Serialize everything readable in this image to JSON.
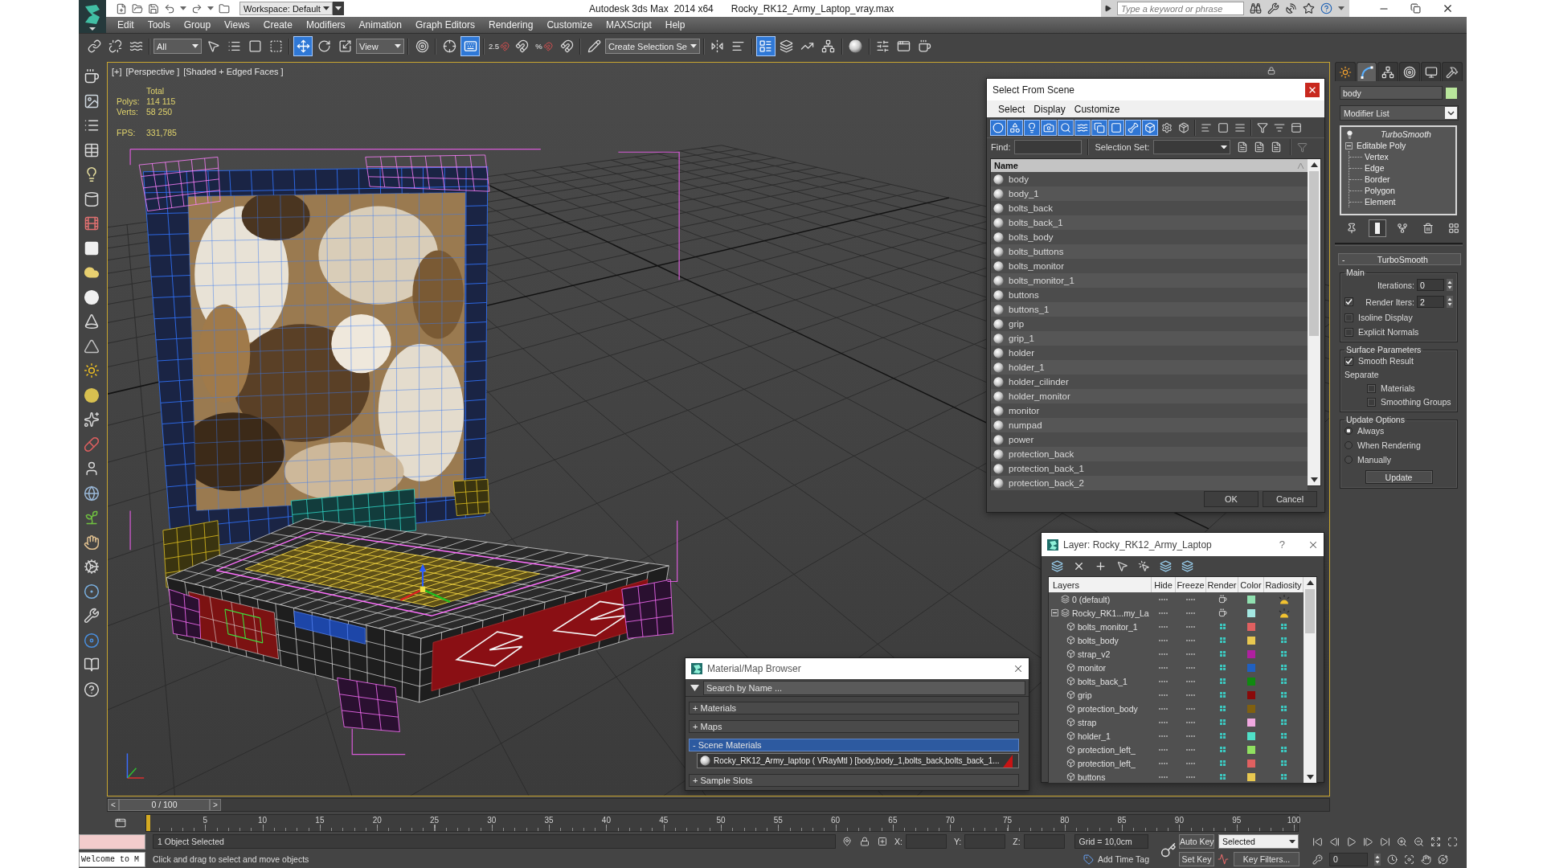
{
  "title_bar": {
    "workspace": "Workspace: Default",
    "app_name": "Autodesk 3ds Max  2014 x64",
    "file_name": "Rocky_RK12_Army_Laptop_vray.max",
    "search": {
      "placeholder": "Type a keyword or phrase"
    }
  },
  "menu_bar": [
    "Edit",
    "Tools",
    "Group",
    "Views",
    "Create",
    "Modifiers",
    "Animation",
    "Graph Editors",
    "Rendering",
    "Customize",
    "MAXScript",
    "Help"
  ],
  "main_toolbar": [
    {
      "kind": "tool",
      "active": false
    },
    {
      "kind": "tool",
      "active": false
    },
    {
      "kind": "tool",
      "active": false
    },
    {
      "kind": "dropdown",
      "value": "All"
    },
    {
      "kind": "tool",
      "active": false
    },
    {
      "kind": "tool",
      "active": false
    },
    {
      "kind": "tool",
      "active": false
    },
    {
      "kind": "tool",
      "active": false
    },
    {
      "kind": "tool",
      "active": true
    },
    {
      "kind": "tool",
      "active": false
    },
    {
      "kind": "tool",
      "active": false
    },
    {
      "kind": "dropdown",
      "value": "View"
    },
    {
      "kind": "tool",
      "active": false
    },
    {
      "kind": "tool",
      "active": false
    },
    {
      "kind": "tool",
      "active": true
    },
    {
      "kind": "snap",
      "label": "2.5",
      "active": false
    },
    {
      "kind": "tool",
      "active": false
    },
    {
      "kind": "snap",
      "label": "%",
      "active": false
    },
    {
      "kind": "tool",
      "active": false
    },
    {
      "kind": "tool",
      "active": false
    },
    {
      "kind": "dropdown",
      "value": "Create Selection Se"
    },
    {
      "kind": "tool",
      "active": false
    },
    {
      "kind": "tool",
      "active": false
    },
    {
      "kind": "tool",
      "active": true
    },
    {
      "kind": "tool",
      "active": false
    },
    {
      "kind": "tool",
      "active": false
    },
    {
      "kind": "tool",
      "active": false
    },
    {
      "kind": "tool",
      "active": false
    },
    {
      "kind": "tool",
      "active": false
    },
    {
      "kind": "tool",
      "active": false
    },
    {
      "kind": "tool",
      "active": false
    }
  ],
  "viewport": {
    "menus": [
      "[+]",
      "[Perspective ]",
      "[Shaded + Edged Faces ]"
    ],
    "stats": {
      "heading": "Total",
      "rows": [
        {
          "label": "Polys:",
          "value": "114 115"
        },
        {
          "label": "Verts:",
          "value": "58 250"
        }
      ],
      "fps": {
        "label": "FPS:",
        "value": "331,785"
      }
    }
  },
  "select_from_scene": {
    "title": "Select From Scene",
    "menu": [
      "Select",
      "Display",
      "Customize"
    ],
    "filters": [
      {
        "active": true
      },
      {
        "active": true
      },
      {
        "active": true
      },
      {
        "active": true
      },
      {
        "active": true
      },
      {
        "active": true
      },
      {
        "active": true
      },
      {
        "active": true
      },
      {
        "active": true
      },
      {
        "active": true
      },
      {
        "active": false
      },
      {
        "active": false
      }
    ],
    "find_label": "Find:",
    "selection_set_label": "Selection Set:",
    "column": "Name",
    "rows": [
      {
        "name": "body",
        "selected": false
      },
      {
        "name": "body_1",
        "selected": false
      },
      {
        "name": "bolts_back",
        "selected": false
      },
      {
        "name": "bolts_back_1",
        "selected": false
      },
      {
        "name": "bolts_body",
        "selected": false
      },
      {
        "name": "bolts_buttons",
        "selected": false
      },
      {
        "name": "bolts_monitor",
        "selected": false
      },
      {
        "name": "bolts_monitor_1",
        "selected": false
      },
      {
        "name": "buttons",
        "selected": false
      },
      {
        "name": "buttons_1",
        "selected": false
      },
      {
        "name": "grip",
        "selected": false
      },
      {
        "name": "grip_1",
        "selected": false
      },
      {
        "name": "holder",
        "selected": false
      },
      {
        "name": "holder_1",
        "selected": false
      },
      {
        "name": "holder_cilinder",
        "selected": false
      },
      {
        "name": "holder_monitor",
        "selected": false
      },
      {
        "name": "monitor",
        "selected": false
      },
      {
        "name": "numpad",
        "selected": false
      },
      {
        "name": "power",
        "selected": false
      },
      {
        "name": "protection_back",
        "selected": false
      },
      {
        "name": "protection_back_1",
        "selected": false
      },
      {
        "name": "protection_back_2",
        "selected": false
      }
    ],
    "buttons": [
      "OK",
      "Cancel"
    ]
  },
  "layer_dialog": {
    "title": "Layer: Rocky_RK12_Army_Laptop",
    "help": "?",
    "columns": [
      "Layers",
      "Hide",
      "Freeze",
      "Render",
      "Color",
      "Radiosity"
    ],
    "rows": [
      {
        "kind": "layer",
        "name": "0 (default)",
        "color": "#90e0b0",
        "selected": false
      },
      {
        "kind": "layer",
        "name": "Rocky_RK1...my_La",
        "color": "#a4e8e2",
        "selected": false,
        "expanded": true,
        "children": [
          {
            "kind": "object",
            "name": "bolts_monitor_1",
            "color": "#e06060",
            "selected": false
          },
          {
            "kind": "object",
            "name": "bolts_body",
            "color": "#e8c850",
            "selected": false
          },
          {
            "kind": "object",
            "name": "strap_v2",
            "color": "#b020a0",
            "selected": false
          },
          {
            "kind": "object",
            "name": "monitor",
            "color": "#2060c0",
            "selected": false
          },
          {
            "kind": "object",
            "name": "bolts_back_1",
            "color": "#108a10",
            "selected": false
          },
          {
            "kind": "object",
            "name": "grip",
            "color": "#8a0a0a",
            "selected": false
          },
          {
            "kind": "object",
            "name": "protection_body",
            "color": "#806010",
            "selected": false
          },
          {
            "kind": "object",
            "name": "strap",
            "color": "#f0a8e0",
            "selected": false
          },
          {
            "kind": "object",
            "name": "holder_1",
            "color": "#50e0c8",
            "selected": false
          },
          {
            "kind": "object",
            "name": "protection_left_",
            "color": "#90e060",
            "selected": false
          },
          {
            "kind": "object",
            "name": "protection_left_",
            "color": "#e06060",
            "selected": false
          },
          {
            "kind": "object",
            "name": "buttons",
            "color": "#e8c850",
            "selected": false
          }
        ]
      }
    ]
  },
  "material_browser": {
    "title": "Material/Map Browser",
    "search": {
      "placeholder": "Search by Name ..."
    },
    "groups": [
      {
        "label": "+ Materials",
        "expanded": false
      },
      {
        "label": "+ Maps",
        "expanded": false
      },
      {
        "label": "- Scene Materials",
        "expanded": true,
        "items": [
          {
            "label": "Rocky_RK12_Army_laptop ( VRayMtl ) [body,body_1,bolts_back,bolts_back_1...",
            "selected": false
          }
        ]
      },
      {
        "label": "+ Sample Slots",
        "expanded": false
      }
    ]
  },
  "command_panel": {
    "tabs": [
      {
        "selected": false
      },
      {
        "selected": true
      },
      {
        "selected": false
      },
      {
        "selected": false
      },
      {
        "selected": false
      },
      {
        "selected": false
      }
    ],
    "object_name": "body",
    "modifier_list": "Modifier List",
    "stack": [
      {
        "kind": "modifier",
        "name": "TurboSmooth",
        "selected": false
      },
      {
        "kind": "base",
        "name": "Editable Poly",
        "selected": false,
        "expanded": true,
        "children": [
          {
            "name": "Vertex",
            "selected": false
          },
          {
            "name": "Edge",
            "selected": false
          },
          {
            "name": "Border",
            "selected": false
          },
          {
            "name": "Polygon",
            "selected": false
          },
          {
            "name": "Element",
            "selected": false
          }
        ]
      }
    ],
    "stack_tools": [
      {
        "active": false
      },
      {
        "active": true
      },
      {
        "active": false
      },
      {
        "active": false
      },
      {
        "active": false
      }
    ],
    "rollout": {
      "sign": "-",
      "title": "TurboSmooth",
      "groups": [
        {
          "title": "Main",
          "controls": [
            {
              "kind": "spinner",
              "label": "Iterations:",
              "value": "0"
            },
            {
              "kind": "spinner",
              "label": "Render Iters:",
              "value": "2",
              "checked": true
            },
            {
              "kind": "checkbox",
              "label": "Isoline Display",
              "checked": false
            },
            {
              "kind": "checkbox",
              "label": "Explicit Normals",
              "checked": false
            }
          ]
        },
        {
          "title": "Surface Parameters",
          "controls": [
            {
              "kind": "checkbox",
              "label": "Smooth Result",
              "checked": true
            },
            {
              "kind": "heading",
              "label": "Separate",
              "children": [
                {
                  "kind": "checkbox",
                  "label": "Materials",
                  "checked": false
                },
                {
                  "kind": "checkbox",
                  "label": "Smoothing Groups",
                  "checked": false
                }
              ]
            }
          ]
        },
        {
          "title": "Update Options",
          "controls": [
            {
              "kind": "radio",
              "label": "Always",
              "selected": true
            },
            {
              "kind": "radio",
              "label": "When Rendering",
              "selected": false
            },
            {
              "kind": "radio",
              "label": "Manually",
              "selected": false
            },
            {
              "kind": "button",
              "label": "Update"
            }
          ]
        }
      ]
    }
  },
  "time_slider": {
    "prev": "<",
    "position": "0 / 100",
    "next": ">",
    "level": 0
  },
  "track_bar": {
    "labels": [
      "5",
      "10",
      "15",
      "20",
      "25",
      "30",
      "35",
      "40",
      "45",
      "50",
      "55",
      "60",
      "65",
      "70",
      "75",
      "80",
      "85",
      "90",
      "95",
      "100"
    ]
  },
  "status_bar": {
    "selection": "1 Object Selected",
    "coords": [
      {
        "label": "X:"
      },
      {
        "label": "Y:"
      },
      {
        "label": "Z:"
      }
    ],
    "grid": "Grid = 10,0cm",
    "auto_key": "Auto Key",
    "key_mode": "Selected",
    "output": "Welcome to M",
    "prompt": "Click and drag to select and move objects",
    "time_tag": "Add Time Tag",
    "set_key": "Set Key",
    "key_filters": "Key Filters...",
    "frame": "0"
  }
}
